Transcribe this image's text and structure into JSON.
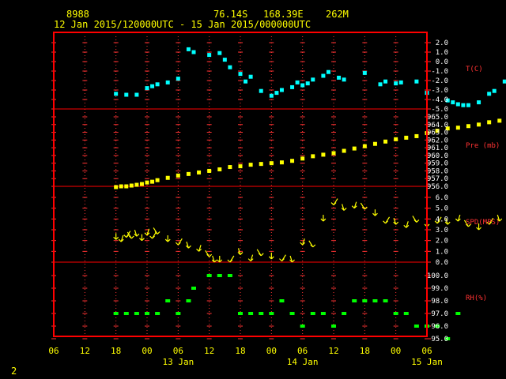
{
  "header": {
    "station": "8988",
    "latitude": "76.14S",
    "longitude": "168.39E",
    "elevation": "262M",
    "period": "12 Jan 2015/120000UTC - 15 Jan 2015/000000UTC"
  },
  "footer": {
    "page_number": "2"
  },
  "colors": {
    "frame": "#ff0000",
    "grid": "#ff3333",
    "temperature": "#00ffff",
    "pressure": "#ffff00",
    "wind": "#ffff00",
    "humidity": "#00ff00",
    "axis_text": "#ffff00",
    "tick_text": "#ffffff"
  },
  "chart_data": {
    "type": "scatter",
    "x_unit": "hours since 12 Jan 2015 06 UTC",
    "x_ticks": [
      "06",
      "12",
      "18",
      "00",
      "06",
      "12",
      "18",
      "00",
      "06",
      "12",
      "18",
      "00",
      "06"
    ],
    "date_labels": [
      {
        "label": "13 Jan",
        "hour": 24
      },
      {
        "label": "14 Jan",
        "hour": 48
      },
      {
        "label": "15 Jan",
        "hour": 72
      }
    ],
    "panels": [
      {
        "name": "T(C)",
        "ticks": [
          "2.0",
          "1.0",
          "0.0",
          "-1.0",
          "-2.0",
          "-3.0",
          "-4.0",
          "-5.0"
        ],
        "range": [
          -5,
          2
        ],
        "points": [
          [
            12,
            -3.4
          ],
          [
            14,
            -3.5
          ],
          [
            16,
            -3.5
          ],
          [
            18,
            -2.8
          ],
          [
            19,
            -2.6
          ],
          [
            20,
            -2.4
          ],
          [
            22,
            -2.2
          ],
          [
            24,
            -1.8
          ],
          [
            26,
            1.3
          ],
          [
            27,
            1.0
          ],
          [
            30,
            0.7
          ],
          [
            32,
            0.9
          ],
          [
            33,
            0.2
          ],
          [
            34,
            -0.6
          ],
          [
            36,
            -1.3
          ],
          [
            37,
            -2.1
          ],
          [
            38,
            -1.6
          ],
          [
            40,
            -3.1
          ],
          [
            42,
            -3.6
          ],
          [
            43,
            -3.3
          ],
          [
            44,
            -3.0
          ],
          [
            46,
            -2.7
          ],
          [
            47,
            -2.2
          ],
          [
            48,
            -2.5
          ],
          [
            49,
            -2.3
          ],
          [
            50,
            -1.9
          ],
          [
            52,
            -1.5
          ],
          [
            53,
            -1.1
          ],
          [
            55,
            -1.7
          ],
          [
            56,
            -1.9
          ],
          [
            60,
            -1.2
          ],
          [
            63,
            -2.4
          ],
          [
            64,
            -2.1
          ],
          [
            66,
            -2.3
          ],
          [
            67,
            -2.2
          ],
          [
            70,
            -2.1
          ],
          [
            72,
            -3.3
          ],
          [
            76,
            -4.1
          ],
          [
            77,
            -4.3
          ],
          [
            78,
            -4.5
          ],
          [
            79,
            -4.6
          ],
          [
            80,
            -4.6
          ],
          [
            82,
            -4.3
          ],
          [
            84,
            -3.4
          ],
          [
            85,
            -3.1
          ],
          [
            87,
            -2.1
          ]
        ]
      },
      {
        "name": "Pre (mb)",
        "ticks": [
          "965.0",
          "964.0",
          "963.0",
          "962.0",
          "961.0",
          "960.0",
          "959.0",
          "958.0",
          "957.0",
          "956.0"
        ],
        "range": [
          956,
          965
        ],
        "points": [
          [
            12,
            955.9
          ],
          [
            13,
            956.0
          ],
          [
            14,
            956.0
          ],
          [
            15,
            956.1
          ],
          [
            16,
            956.2
          ],
          [
            17,
            956.3
          ],
          [
            18,
            956.5
          ],
          [
            19,
            956.6
          ],
          [
            20,
            956.8
          ],
          [
            22,
            957.1
          ],
          [
            24,
            957.4
          ],
          [
            26,
            957.6
          ],
          [
            28,
            957.8
          ],
          [
            30,
            958.0
          ],
          [
            32,
            958.2
          ],
          [
            34,
            958.5
          ],
          [
            36,
            958.6
          ],
          [
            38,
            958.8
          ],
          [
            40,
            958.9
          ],
          [
            42,
            959.0
          ],
          [
            44,
            959.1
          ],
          [
            46,
            959.3
          ],
          [
            48,
            959.6
          ],
          [
            50,
            959.9
          ],
          [
            52,
            960.1
          ],
          [
            54,
            960.3
          ],
          [
            56,
            960.6
          ],
          [
            58,
            960.9
          ],
          [
            60,
            961.2
          ],
          [
            62,
            961.5
          ],
          [
            64,
            961.8
          ],
          [
            66,
            962.1
          ],
          [
            68,
            962.3
          ],
          [
            70,
            962.5
          ],
          [
            72,
            962.9
          ],
          [
            74,
            963.2
          ],
          [
            76,
            963.5
          ],
          [
            78,
            963.6
          ],
          [
            80,
            963.8
          ],
          [
            82,
            964.0
          ],
          [
            84,
            964.3
          ],
          [
            86,
            964.5
          ],
          [
            88,
            964.8
          ],
          [
            90,
            965.0
          ]
        ]
      },
      {
        "name": "SPD(MPS)",
        "ticks": [
          "6.0",
          "5.0",
          "4.0",
          "3.0",
          "2.0",
          "1.0",
          "0.0"
        ],
        "range": [
          0,
          6
        ],
        "points": [
          [
            12,
            2.1
          ],
          [
            13,
            1.9
          ],
          [
            14,
            2.3
          ],
          [
            15,
            2.2
          ],
          [
            16,
            2.4
          ],
          [
            17,
            2.0
          ],
          [
            18,
            2.5
          ],
          [
            19,
            2.2
          ],
          [
            20,
            2.6
          ],
          [
            22,
            1.9
          ],
          [
            24,
            1.6
          ],
          [
            26,
            1.3
          ],
          [
            28,
            1.0
          ],
          [
            30,
            0.5
          ],
          [
            31,
            0.0
          ],
          [
            32,
            0.0
          ],
          [
            34,
            0.0
          ],
          [
            36,
            0.7
          ],
          [
            38,
            0.1
          ],
          [
            40,
            0.6
          ],
          [
            42,
            0.3
          ],
          [
            44,
            0.1
          ],
          [
            46,
            0.0
          ],
          [
            48,
            1.6
          ],
          [
            50,
            1.4
          ],
          [
            52,
            3.8
          ],
          [
            54,
            5.3
          ],
          [
            56,
            4.8
          ],
          [
            58,
            5.0
          ],
          [
            60,
            4.9
          ],
          [
            62,
            4.3
          ],
          [
            64,
            3.6
          ],
          [
            66,
            3.5
          ],
          [
            68,
            3.2
          ],
          [
            70,
            3.7
          ],
          [
            72,
            3.3
          ],
          [
            74,
            3.6
          ],
          [
            76,
            3.5
          ],
          [
            78,
            3.8
          ],
          [
            80,
            3.3
          ],
          [
            82,
            3.0
          ],
          [
            84,
            3.5
          ],
          [
            86,
            3.8
          ],
          [
            88,
            3.3
          ]
        ]
      },
      {
        "name": "RH(%)",
        "ticks": [
          "100.0",
          "99.0",
          "98.0",
          "97.0",
          "96.0",
          "95.0"
        ],
        "range": [
          95,
          100
        ],
        "points": [
          [
            12,
            97.0
          ],
          [
            14,
            97.0
          ],
          [
            16,
            97.0
          ],
          [
            18,
            97.0
          ],
          [
            20,
            97.0
          ],
          [
            22,
            98.0
          ],
          [
            24,
            97.0
          ],
          [
            26,
            98.0
          ],
          [
            27,
            99.0
          ],
          [
            30,
            100.0
          ],
          [
            32,
            100.0
          ],
          [
            34,
            100.0
          ],
          [
            36,
            97.0
          ],
          [
            38,
            97.0
          ],
          [
            40,
            97.0
          ],
          [
            42,
            97.0
          ],
          [
            44,
            98.0
          ],
          [
            46,
            97.0
          ],
          [
            48,
            96.0
          ],
          [
            50,
            97.0
          ],
          [
            52,
            97.0
          ],
          [
            54,
            96.0
          ],
          [
            56,
            97.0
          ],
          [
            58,
            98.0
          ],
          [
            60,
            98.0
          ],
          [
            62,
            98.0
          ],
          [
            64,
            98.0
          ],
          [
            66,
            97.0
          ],
          [
            68,
            97.0
          ],
          [
            70,
            96.0
          ],
          [
            72,
            96.0
          ],
          [
            74,
            96.0
          ],
          [
            76,
            95.0
          ],
          [
            78,
            97.0
          ]
        ]
      }
    ]
  }
}
